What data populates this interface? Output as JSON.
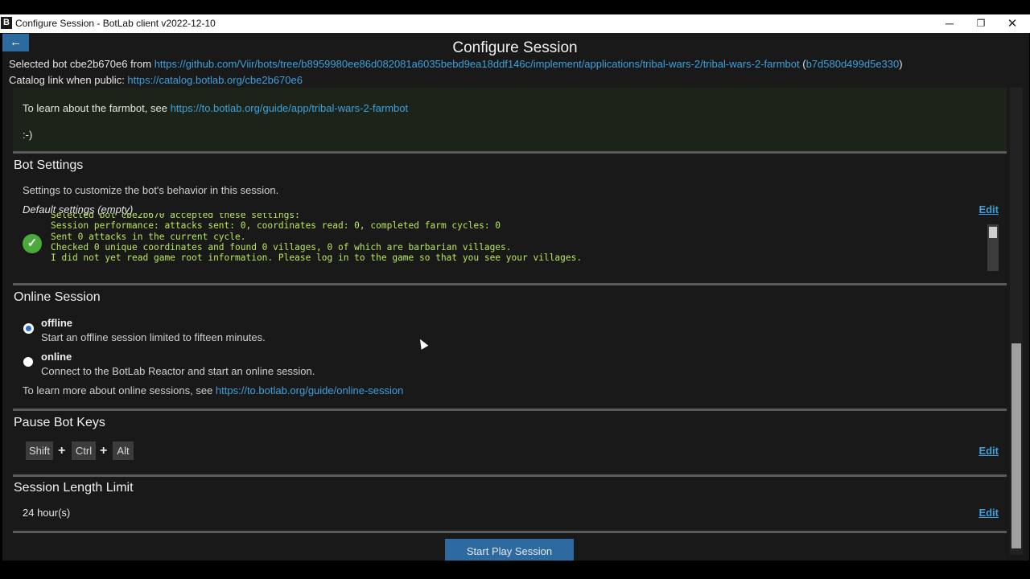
{
  "window": {
    "icon_letter": "B",
    "title": "Configure Session - BotLab client v2022-12-10",
    "minimize": "─",
    "maximize": "❐",
    "close": "✕"
  },
  "header": {
    "back_label": "←",
    "title": "Configure Session",
    "selected_bot_prefix": "Selected bot cbe2b670e6 from ",
    "source_url": "https://github.com/Viir/bots/tree/b8959980ee86d082081a6035bebd9ea18ddf146c/implement/applications/tribal-wars-2/tribal-wars-2-farmbot",
    "commit_open": " (",
    "commit_hash": "b7d580d499d5e330",
    "commit_close": ")",
    "catalog_prefix": "Catalog link when public: ",
    "catalog_url": "https://catalog.botlab.org/cbe2b670e6"
  },
  "readme": {
    "learn_prefix": "To learn about the farmbot, see ",
    "learn_url": "https://to.botlab.org/guide/app/tribal-wars-2-farmbot",
    "smiley": ":-)"
  },
  "bot_settings": {
    "heading": "Bot Settings",
    "description": "Settings to customize the bot's behavior in this session.",
    "default_label": "Default settings (empty)",
    "edit_label": "Edit",
    "status_icon": "check-circle-icon",
    "status_log": "Selected bot cbe2b670 accepted these settings:\nSession performance: attacks sent: 0, coordinates read: 0, completed farm cycles: 0\nSent 0 attacks in the current cycle.\nChecked 0 unique coordinates and found 0 villages, 0 of which are barbarian villages.\nI did not yet read game root information. Please log in to the game so that you see your villages."
  },
  "online_session": {
    "heading": "Online Session",
    "options": [
      {
        "label": "offline",
        "description": "Start an offline session limited to fifteen minutes.",
        "selected": true
      },
      {
        "label": "online",
        "description": "Connect to the BotLab Reactor and start an online session.",
        "selected": false
      }
    ],
    "learn_prefix": "To learn more about online sessions, see ",
    "learn_url": "https://to.botlab.org/guide/online-session"
  },
  "pause_keys": {
    "heading": "Pause Bot Keys",
    "keys": [
      "Shift",
      "Ctrl",
      "Alt"
    ],
    "plus": "+",
    "edit_label": "Edit"
  },
  "session_limit": {
    "heading": "Session Length Limit",
    "value": "24 hour(s)",
    "edit_label": "Edit"
  },
  "start_button": "Start Play Session",
  "colors": {
    "accent_blue": "#2c6aa0",
    "link_blue": "#3ea0dc",
    "log_green": "#b8e85a",
    "check_green": "#4caa3c"
  }
}
